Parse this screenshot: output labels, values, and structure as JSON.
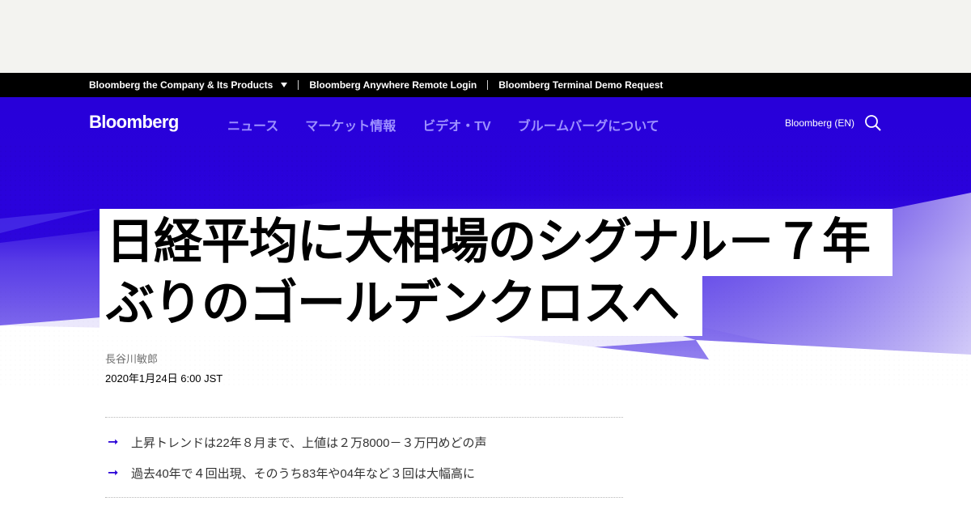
{
  "corp_bar": {
    "company": "Bloomberg the Company & Its Products",
    "anywhere": "Bloomberg Anywhere Remote Login",
    "terminal": "Bloomberg Terminal Demo Request"
  },
  "nav": {
    "logo": "Bloomberg",
    "links": [
      "ニュース",
      "マーケット情報",
      "ビデオ・TV",
      "ブルームバーグについて"
    ],
    "edition": "Bloomberg (EN)"
  },
  "article": {
    "headline_line1": "日経平均に大相場のシグナル－７年",
    "headline_line2": "ぶりのゴールデンクロスへ",
    "author": "長谷川敏郎",
    "timestamp": "2020年1月24日 6:00 JST",
    "bullets": [
      "上昇トレンドは22年８月まで、上値は２万8000－３万円めどの声",
      "過去40年で４回出現、そのうち83年や04年など３回は大幅高に"
    ]
  },
  "icons": {
    "search": "search-icon",
    "dropdown": "caret-down-icon",
    "bullet": "arrow-right-icon"
  },
  "colors": {
    "brand_blue": "#2800d7",
    "nav_link": "#9d90ff"
  }
}
